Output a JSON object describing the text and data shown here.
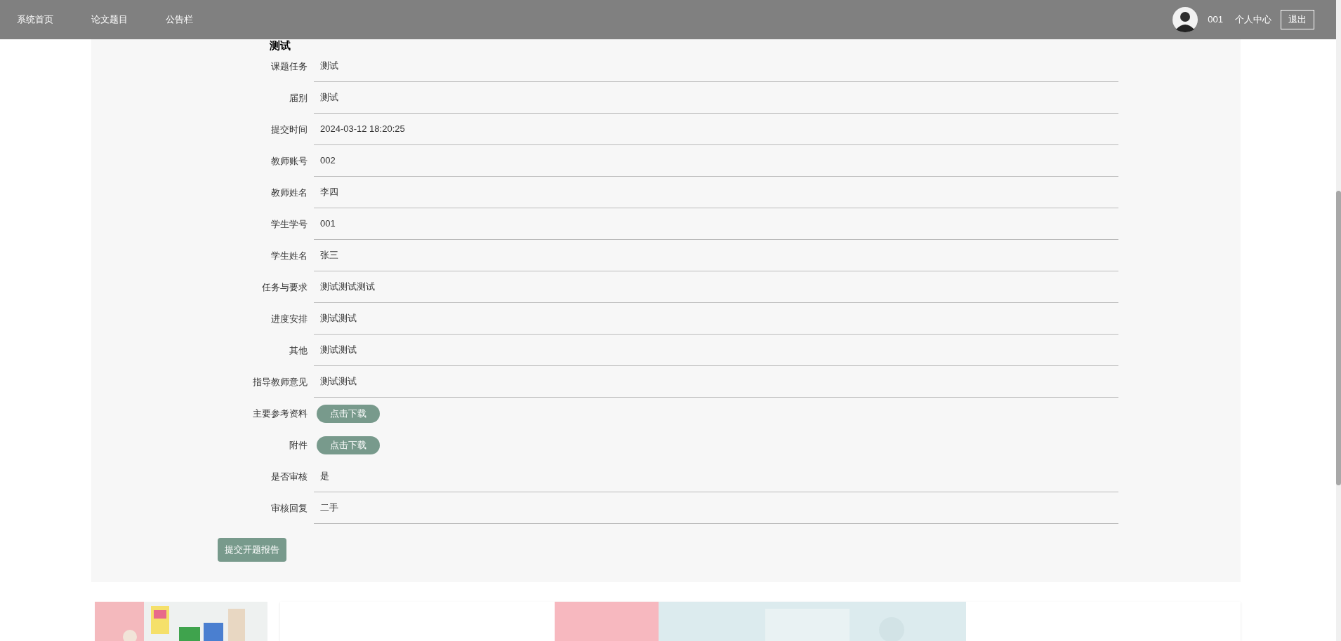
{
  "nav": {
    "items": [
      "系统首页",
      "论文题目",
      "公告栏"
    ],
    "user": "001",
    "profile": "个人中心",
    "logout": "退出"
  },
  "detail": {
    "title": "测试",
    "fields": [
      {
        "kind": "text",
        "label": "课题任务",
        "value": "测试"
      },
      {
        "kind": "text",
        "label": "届别",
        "value": "测试"
      },
      {
        "kind": "text",
        "label": "提交时间",
        "value": "2024-03-12 18:20:25"
      },
      {
        "kind": "text",
        "label": "教师账号",
        "value": "002"
      },
      {
        "kind": "text",
        "label": "教师姓名",
        "value": "李四"
      },
      {
        "kind": "text",
        "label": "学生学号",
        "value": "001"
      },
      {
        "kind": "text",
        "label": "学生姓名",
        "value": "张三"
      },
      {
        "kind": "text",
        "label": "任务与要求",
        "value": "测试测试测试"
      },
      {
        "kind": "text",
        "label": "进度安排",
        "value": "测试测试"
      },
      {
        "kind": "text",
        "label": "其他",
        "value": "测试测试"
      },
      {
        "kind": "text",
        "label": "指导教师意见",
        "value": "测试测试"
      },
      {
        "kind": "download",
        "label": "主要参考资料",
        "value": "点击下载"
      },
      {
        "kind": "download",
        "label": "附件",
        "value": "点击下载"
      },
      {
        "kind": "text",
        "label": "是否审核",
        "value": "是"
      },
      {
        "kind": "text",
        "label": "审核回复",
        "value": "二手"
      }
    ],
    "submit": "提交开题报告"
  }
}
